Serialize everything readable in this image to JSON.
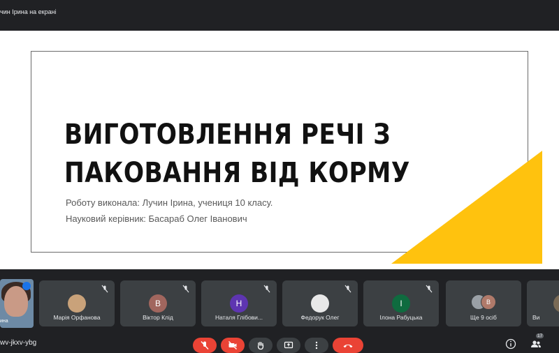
{
  "header": {
    "presenting_text": "чин Ірина на екрані"
  },
  "slide": {
    "title_lines": [
      "ВИГОТОВЛЕННЯ РЕЧІ З",
      "ПАКОВАННЯ ВІД КОРМУ"
    ],
    "author": "Роботу виконала: Лучин Ірина, учениця 10 класу.",
    "supervisor": "Науковий керівник: Басараб Олег Іванович",
    "accent_color": "#FFC20E"
  },
  "participants": {
    "self": {
      "label": "ина"
    },
    "tiles": [
      {
        "name": "Марія Орфанова",
        "initial": "",
        "avatar_color": "#c9a27a"
      },
      {
        "name": "Віктор Клід",
        "initial": "В",
        "avatar_color": "#a1665e"
      },
      {
        "name": "Наталя Глібови...",
        "initial": "Н",
        "avatar_color": "#5e35b1"
      },
      {
        "name": "Федорук Олег",
        "initial": "",
        "avatar_color": "#e8e8e8"
      },
      {
        "name": "Ілона Рабуцька",
        "initial": "І",
        "avatar_color": "#0f6b3f"
      }
    ],
    "more": {
      "label": "Ще 9 осіб",
      "initial": "В"
    },
    "last": {
      "name": "Ви"
    }
  },
  "footer": {
    "meeting_code": "wv-jkxv-ybg",
    "participant_count": "17"
  }
}
